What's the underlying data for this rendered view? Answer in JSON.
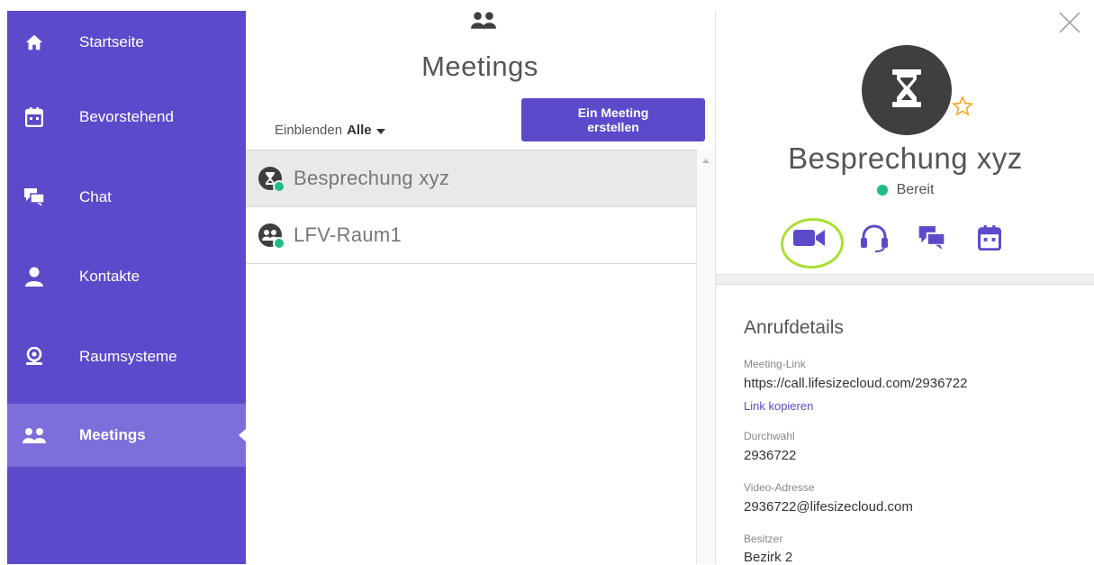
{
  "sidebar": {
    "items": [
      {
        "label": "Startseite",
        "icon": "home-icon"
      },
      {
        "label": "Bevorstehend",
        "icon": "calendar-icon"
      },
      {
        "label": "Chat",
        "icon": "chat-icon"
      },
      {
        "label": "Kontakte",
        "icon": "person-icon"
      },
      {
        "label": "Raumsysteme",
        "icon": "room-system-icon"
      },
      {
        "label": "Meetings",
        "icon": "meetings-icon",
        "active": true
      }
    ]
  },
  "list_pane": {
    "title": "Meetings",
    "filter_prefix": "Einblenden",
    "filter_value": "Alle",
    "create_button": "Ein Meeting\nerstellen",
    "items": [
      {
        "name": "Besprechung xyz",
        "icon": "hourglass-icon",
        "status": "online",
        "selected": true
      },
      {
        "name": "LFV-Raum1",
        "icon": "meetings-icon",
        "status": "online",
        "selected": false
      }
    ]
  },
  "details": {
    "title": "Besprechung xyz",
    "status": "Bereit",
    "section_title": "Anrufdetails",
    "fields": {
      "meeting_link_label": "Meeting-Link",
      "meeting_link_value": "https://call.lifesizecloud.com/2936722",
      "copy_link": "Link kopieren",
      "extension_label": "Durchwahl",
      "extension_value": "2936722",
      "video_address_label": "Video-Adresse",
      "video_address_value": "2936722@lifesizecloud.com",
      "owner_label": "Besitzer",
      "owner_value": "Bezirk 2"
    }
  },
  "colors": {
    "accent": "#5b4bcb",
    "sidebar_active": "#7c6fdb",
    "status_green": "#1fbd85",
    "star_orange": "#f5a623",
    "highlight_green": "#a8df30"
  }
}
